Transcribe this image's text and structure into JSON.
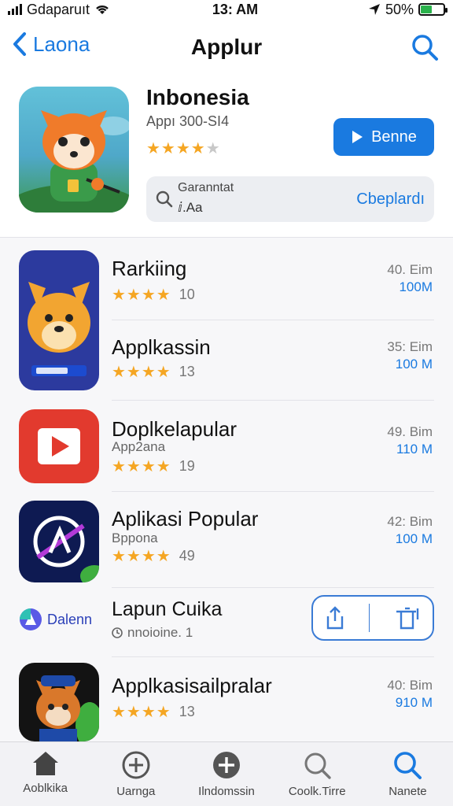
{
  "status_bar": {
    "carrier": "Gdaparuıt",
    "time": "13: AM",
    "battery": "50%",
    "battery_level": 0.5
  },
  "nav": {
    "back_label": "Laona",
    "title": "Applur"
  },
  "featured": {
    "name": "Inbonesia",
    "subtitle": "Appı 300-SI4",
    "rating": 4,
    "button_label": "Benne",
    "search_label_1": "Garanntat",
    "search_label_2": "ⅈ.Aa",
    "search_action": "Cbeplardı"
  },
  "apps": [
    {
      "name": "Rarkiing",
      "subtitle": "",
      "rating": 4,
      "count": "10",
      "meta1": "40. Eim",
      "meta2": "100M"
    },
    {
      "name": "Applkassin",
      "subtitle": "",
      "rating": 4,
      "count": "13",
      "meta1": "35: Eim",
      "meta2": "100 M"
    },
    {
      "name": "Doplkelapular",
      "subtitle": "App2ana",
      "rating": 4,
      "count": "19",
      "meta1": "49. Bim",
      "meta2": "110 M"
    },
    {
      "name": "Aplikasi Popular",
      "subtitle": "Bppona",
      "rating": 4,
      "count": "49",
      "meta1": "42: Bim",
      "meta2": "100 M"
    },
    {
      "name": "Lapun Cuika",
      "subtitle": "nnoioine. 1",
      "logo_text": "Dalenn"
    },
    {
      "name": "Applkasisailpralar",
      "subtitle": "",
      "rating": 4,
      "count": "13",
      "meta1": "40: Bim",
      "meta2": "910 M"
    }
  ],
  "tabs": [
    {
      "label": "Aoblkika",
      "icon": "home-icon"
    },
    {
      "label": "Uarnga",
      "icon": "add-circle-icon"
    },
    {
      "label": "Ilndomssin",
      "icon": "add-circle-filled-icon"
    },
    {
      "label": "Coolk.Tirre",
      "icon": "search-icon"
    },
    {
      "label": "Nanete",
      "icon": "search-icon"
    }
  ],
  "colors": {
    "accent": "#1a7ae0",
    "star": "#f5a623",
    "battery": "#2bb24c"
  }
}
